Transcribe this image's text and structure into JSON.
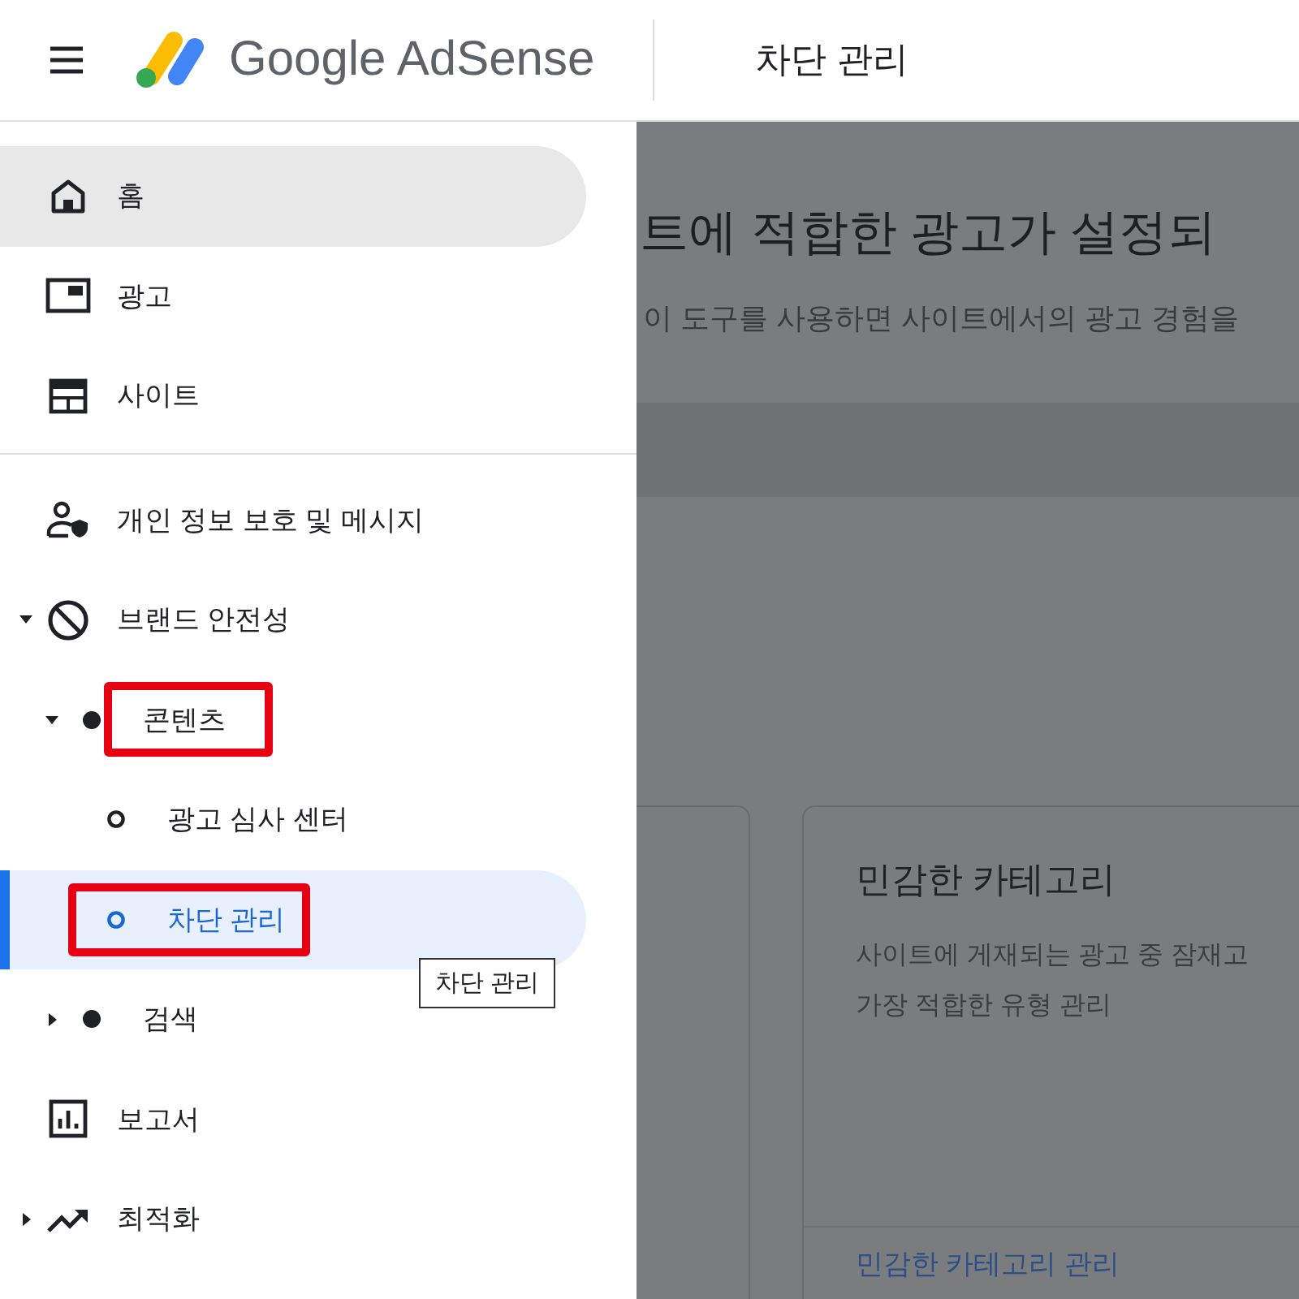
{
  "header": {
    "logo_text": "Google AdSense",
    "page_title": "차단 관리"
  },
  "nav": {
    "groups": [
      [
        {
          "label": "홈",
          "selected": true
        },
        {
          "label": "광고",
          "selected": false
        },
        {
          "label": "사이트",
          "selected": false
        }
      ],
      [
        {
          "label": "개인 정보 보호 및 메시지",
          "selected": false
        },
        {
          "label": "브랜드 안전성",
          "selected": false,
          "expanded": true,
          "children": [
            {
              "label": "콘텐츠",
              "selected": false,
              "expanded": true,
              "highlighted": true,
              "children": [
                {
                  "label": "광고 심사 센터",
                  "selected": false,
                  "highlighted": false
                },
                {
                  "label": "차단 관리",
                  "selected": true,
                  "highlighted": true
                }
              ]
            },
            {
              "label": "검색",
              "selected": false,
              "expanded": false,
              "highlighted": false
            }
          ]
        },
        {
          "label": "보고서",
          "selected": false
        },
        {
          "label": "최적화",
          "selected": false,
          "expanded": false
        }
      ]
    ]
  },
  "tooltip": "차단 관리",
  "main": {
    "heading": "트에 적합한 광고가 설정되",
    "description": "이 도구를 사용하면 사이트에서의 광고 경험을",
    "cards": [
      {
        "title": "민감한 카테고리",
        "description_lines": [
          "사이트에 게재되는 광고 중 잠재고",
          "가장 적합한 유형 관리"
        ],
        "link": "민감한 카테고리 관리"
      }
    ]
  }
}
